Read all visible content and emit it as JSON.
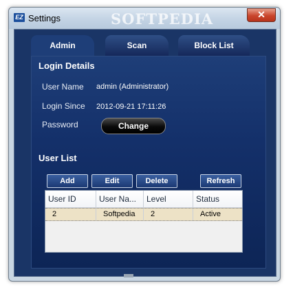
{
  "window": {
    "title": "Settings",
    "app_icon": "EZ",
    "watermark": "SOFTPEDIA",
    "close_symbol": "✕"
  },
  "tabs": [
    {
      "label": "Admin",
      "active": true
    },
    {
      "label": "Scan",
      "active": false
    },
    {
      "label": "Block List",
      "active": false
    }
  ],
  "login": {
    "title": "Login Details",
    "user_name_label": "User Name",
    "user_name_value": "admin  (Administrator)",
    "login_since_label": "Login Since",
    "login_since_value": "2012-09-21 17:11:26",
    "password_label": "Password",
    "change_button": "Change"
  },
  "user_list": {
    "title": "User List",
    "buttons": {
      "add": "Add",
      "edit": "Edit",
      "delete": "Delete",
      "refresh": "Refresh"
    },
    "columns": [
      "User ID",
      "User Na...",
      "Level",
      "Status"
    ],
    "rows": [
      [
        "2",
        "Softpedia",
        "2",
        "Active"
      ]
    ]
  },
  "colors": {
    "panel_bg": "#1a3566",
    "selected_row": "#ede2c6",
    "close_button": "#c9452c"
  }
}
